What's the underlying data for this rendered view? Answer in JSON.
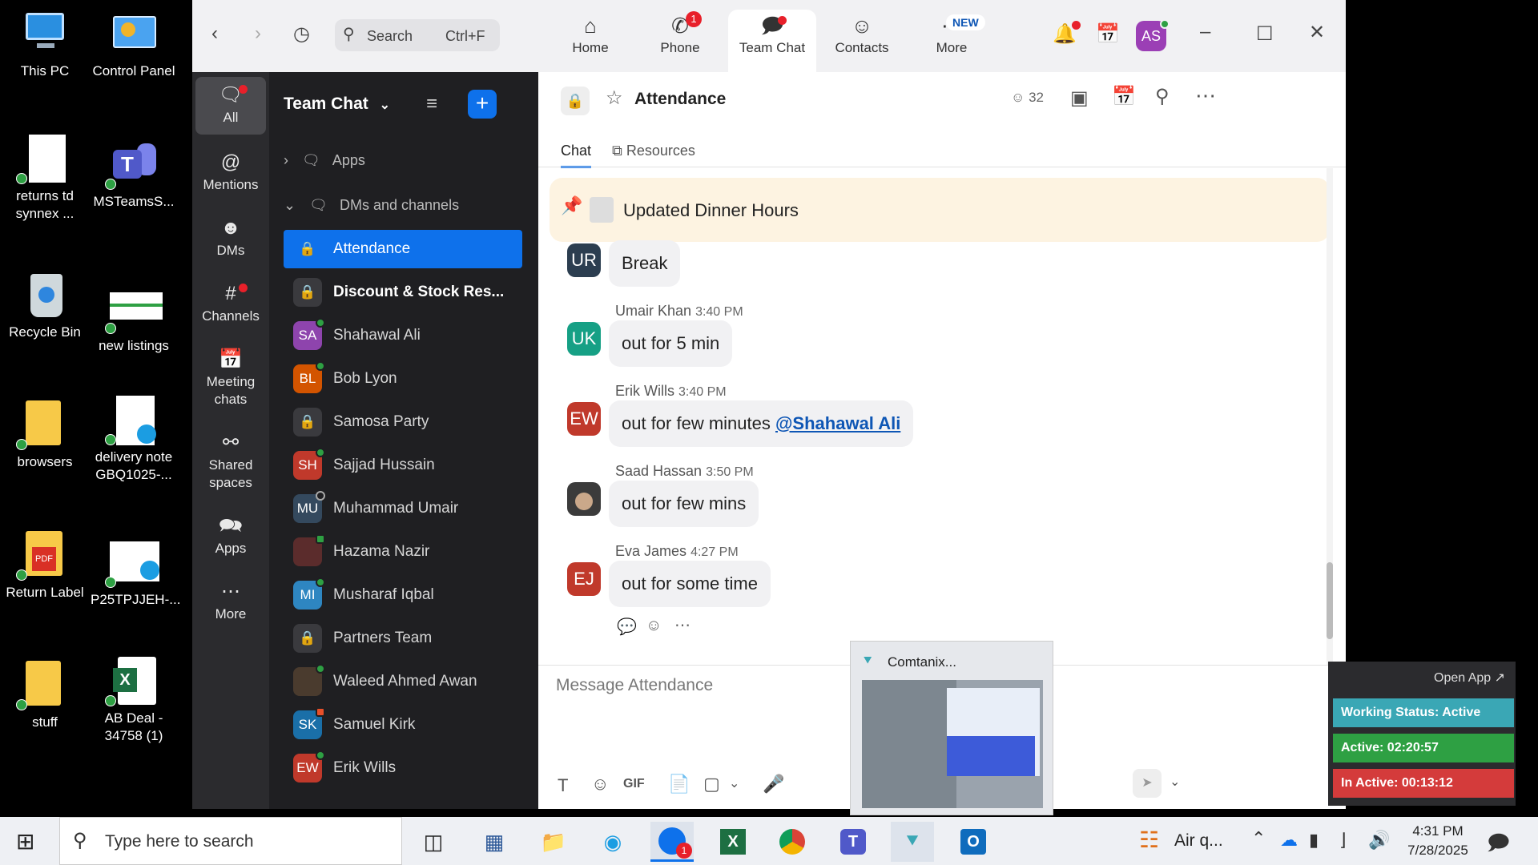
{
  "desktop": {
    "icons": [
      {
        "label": "This PC"
      },
      {
        "label": "Control Panel"
      },
      {
        "label": "returns td synnex ..."
      },
      {
        "label": "MSTeamsS..."
      },
      {
        "label": "Recycle Bin"
      },
      {
        "label": "new listings"
      },
      {
        "label": "browsers"
      },
      {
        "label": "delivery note GBQ1025-..."
      },
      {
        "label": "Return Label"
      },
      {
        "label": "P25TPJJEH-..."
      },
      {
        "label": "stuff"
      },
      {
        "label": "AB Deal - 34758 (1)"
      }
    ]
  },
  "titlebar": {
    "search_label": "Search",
    "search_shortcut": "Ctrl+F",
    "tabs": [
      {
        "label": "Home",
        "icon": "home-icon"
      },
      {
        "label": "Phone",
        "icon": "phone-icon",
        "badge": "1"
      },
      {
        "label": "Team Chat",
        "icon": "chat-icon",
        "active": true
      },
      {
        "label": "Contacts",
        "icon": "contacts-icon"
      },
      {
        "label": "More",
        "icon": "more-icon",
        "badge": "NEW"
      }
    ],
    "avatar_initials": "AS"
  },
  "rail": {
    "items": [
      {
        "label": "All"
      },
      {
        "label": "Mentions"
      },
      {
        "label": "DMs"
      },
      {
        "label": "Channels"
      },
      {
        "label": "Meeting chats"
      },
      {
        "label": "Shared spaces"
      },
      {
        "label": "Apps"
      },
      {
        "label": "More"
      }
    ]
  },
  "sidebar": {
    "title": "Team Chat",
    "apps_label": "Apps",
    "section_label": "DMs and channels",
    "items": [
      {
        "label": "Attendance",
        "initials": "",
        "color": "#0e71eb"
      },
      {
        "label": "Discount & Stock Res...",
        "initials": "",
        "color": "#3a3a3e"
      },
      {
        "label": "Shahawal Ali",
        "initials": "SA",
        "color": "#8e44ad"
      },
      {
        "label": "Bob Lyon",
        "initials": "BL",
        "color": "#d35400"
      },
      {
        "label": "Samosa Party",
        "initials": "",
        "color": "#3a3a3e"
      },
      {
        "label": "Sajjad Hussain",
        "initials": "SH",
        "color": "#c0392b"
      },
      {
        "label": "Muhammad Umair",
        "initials": "MU",
        "color": "#34495e"
      },
      {
        "label": "Hazama Nazir",
        "initials": "",
        "color": "#5b2c2c"
      },
      {
        "label": "Musharaf Iqbal",
        "initials": "MI",
        "color": "#2e86c1"
      },
      {
        "label": "Partners Team",
        "initials": "",
        "color": "#3a3a3e"
      },
      {
        "label": "Waleed Ahmed Awan",
        "initials": "",
        "color": "#4a3b2e"
      },
      {
        "label": "Samuel Kirk",
        "initials": "SK",
        "color": "#1a6fa8"
      },
      {
        "label": "Erik Wills",
        "initials": "EW",
        "color": "#c0392b"
      }
    ]
  },
  "chat": {
    "title": "Attendance",
    "member_count": "32",
    "tab_chat": "Chat",
    "tab_resources": "Resources",
    "pinned": "Updated Dinner Hours",
    "messages": [
      {
        "initials": "UR",
        "color": "#2c3e50",
        "sender": "",
        "time": "",
        "text": "Break"
      },
      {
        "initials": "UK",
        "color": "#16a085",
        "sender": "Umair Khan",
        "time": "3:40 PM",
        "text": "out for 5 min"
      },
      {
        "initials": "EW",
        "color": "#c0392b",
        "sender": "Erik Wills",
        "time": "3:40 PM",
        "text": "out for few minutes ",
        "mention": "@Shahawal Ali"
      },
      {
        "initials": "",
        "color": "#3b3b3b",
        "sender": "Saad Hassan",
        "time": "3:50 PM",
        "text": "out for few mins"
      },
      {
        "initials": "EJ",
        "color": "#c0392b",
        "sender": "Eva James",
        "time": "4:27 PM",
        "text": "out for some time"
      }
    ],
    "composer_placeholder": "Message Attendance",
    "gif_label": "GIF"
  },
  "popup": {
    "title": "Comtanix..."
  },
  "widget": {
    "open_app": "Open App ↗",
    "working_status": "Working Status: Active",
    "active": "Active: 02:20:57",
    "inactive": "In Active: 00:13:12"
  },
  "taskbar": {
    "search_placeholder": "Type here to search",
    "weather_label": "Air q...",
    "time": "4:31 PM",
    "date": "7/28/2025",
    "zoom_badge": "1"
  },
  "colors": {
    "accent": "#0e71eb",
    "pinned_bg": "#fdf3e1",
    "widget_active": "#2ea043",
    "widget_inactive": "#d43b3b",
    "widget_status": "#3aa7b5"
  }
}
